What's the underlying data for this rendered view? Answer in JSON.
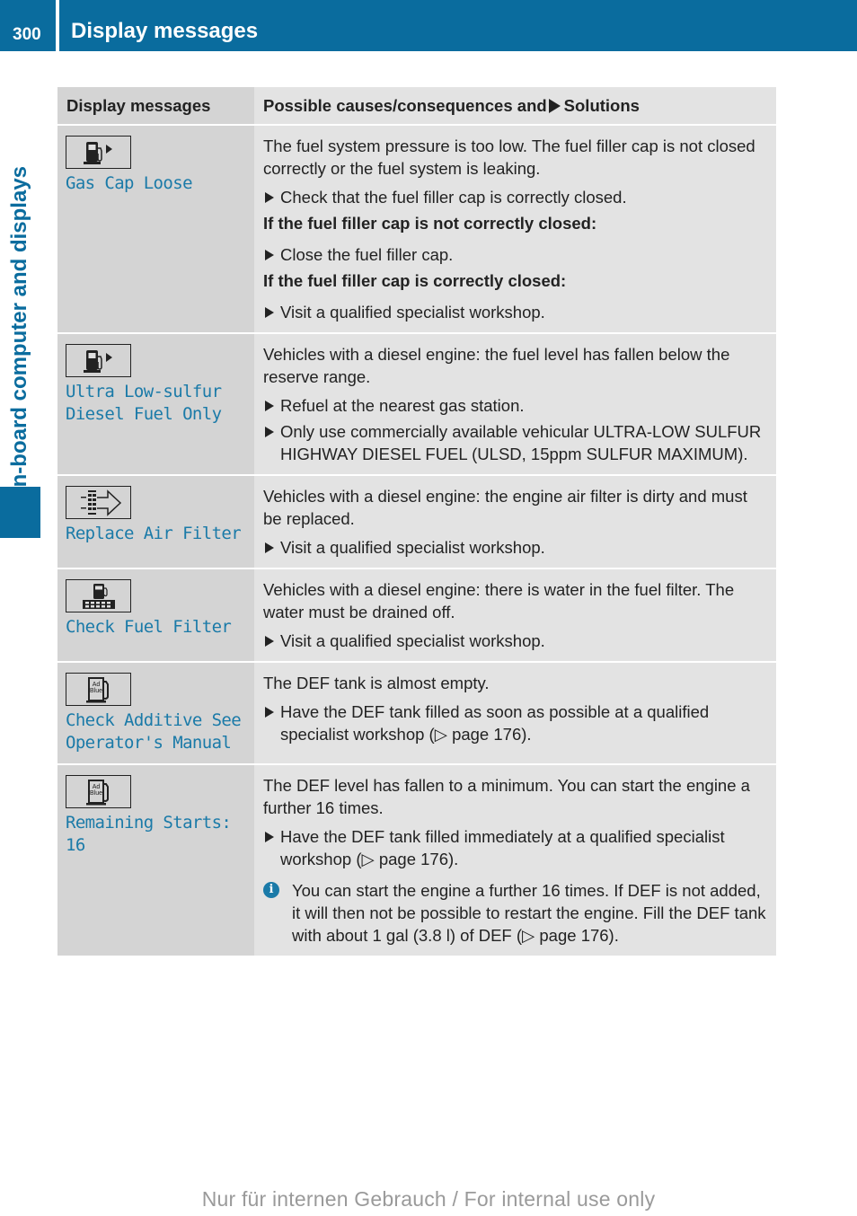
{
  "header": {
    "page_number": "300",
    "title": "Display messages"
  },
  "side_tab": {
    "label": "On-board computer and displays"
  },
  "table": {
    "columns": {
      "messages": "Display messages",
      "solutions_prefix": "Possible causes/consequences and",
      "solutions_suffix": "Solutions"
    },
    "rows": [
      {
        "icon": "fuel-pump-arrow-icon",
        "message": "Gas Cap Loose",
        "description": "The fuel system pressure is too low. The fuel filler cap is not closed correctly or the fuel system is leaking.",
        "steps": [
          {
            "type": "bullet",
            "text": "Check that the fuel filler cap is correctly closed."
          },
          {
            "type": "bold",
            "text": "If the fuel filler cap is not correctly closed:"
          },
          {
            "type": "bullet",
            "text": "Close the fuel filler cap."
          },
          {
            "type": "bold",
            "text": "If the fuel filler cap is correctly closed:"
          },
          {
            "type": "bullet",
            "text": "Visit a qualified specialist workshop."
          }
        ]
      },
      {
        "icon": "fuel-pump-arrow-icon",
        "message": "Ultra Low-sulfur\nDiesel Fuel Only",
        "description": "Vehicles with a diesel engine: the fuel level has fallen below the reserve range.",
        "steps": [
          {
            "type": "bullet",
            "text": "Refuel at the nearest gas station."
          },
          {
            "type": "bullet",
            "text": "Only use commercially available vehicular ULTRA-LOW SULFUR HIGHWAY DIESEL FUEL (ULSD, 15ppm SULFUR MAXIMUM)."
          }
        ]
      },
      {
        "icon": "air-filter-icon",
        "message": "Replace Air Filter",
        "description": "Vehicles with a diesel engine: the engine air filter is dirty and must be replaced.",
        "steps": [
          {
            "type": "bullet",
            "text": "Visit a qualified specialist workshop."
          }
        ]
      },
      {
        "icon": "fuel-filter-icon",
        "message": "Check Fuel Filter",
        "description": "Vehicles with a diesel engine: there is water in the fuel filter. The water must be drained off.",
        "steps": [
          {
            "type": "bullet",
            "text": "Visit a qualified specialist workshop."
          }
        ]
      },
      {
        "icon": "adblue-pump-icon",
        "icon_label": [
          "Ad",
          "Blue"
        ],
        "message": "Check Additive See\nOperator's Manual",
        "description": "The DEF tank is almost empty.",
        "steps": [
          {
            "type": "bullet",
            "text": "Have the DEF tank filled as soon as possible at a qualified specialist workshop (▷ page 176)."
          }
        ]
      },
      {
        "icon": "adblue-pump-icon",
        "icon_label": [
          "Ad",
          "Blue"
        ],
        "message": "Remaining Starts:\n16",
        "description": "The DEF level has fallen to a minimum. You can start the engine a further 16 times.",
        "steps": [
          {
            "type": "bullet",
            "text": "Have the DEF tank filled immediately at a qualified specialist workshop (▷ page 176)."
          }
        ],
        "info": "You can start the engine a further 16 times. If DEF is not added, it will then not be possible to restart the engine. Fill the DEF tank with about 1 gal (3.8 l) of DEF (▷ page 176)."
      }
    ]
  },
  "footer": {
    "watermark": "Nur für internen Gebrauch / For internal use only"
  },
  "colors": {
    "brand_blue": "#0a6c9e",
    "message_text": "#1a7aa8",
    "header_cell": "#d4d4d4",
    "body_cell": "#e3e3e3"
  }
}
